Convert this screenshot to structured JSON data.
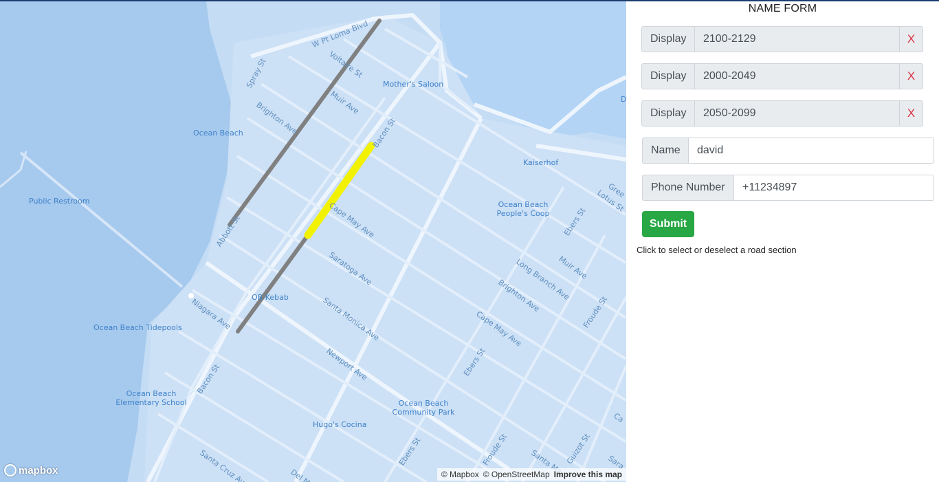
{
  "map": {
    "pois": {
      "mothers_saloon": "Mother's Saloon",
      "ocean_beach": "Ocean Beach",
      "public_restroom": "Public Restroom",
      "kaiserhof": "Kaiserhof",
      "people_coop": "Ocean Beach People's Coop",
      "ob_kebab": "OB Kebab",
      "tidepools": "Ocean Beach Tidepools",
      "elementary": "Ocean Beach Elementary School",
      "community_park": "Ocean Beach Community Park",
      "hugos": "Hugo's Cocina",
      "d_label": "D"
    },
    "streets": {
      "pt_loma": "W Pt Loma Blvd",
      "voltaire": "Voltaire St",
      "spray": "Spray St",
      "muir1": "Muir Ave",
      "brighton1": "Brighton Ave",
      "bacon_top": "Bacon St",
      "cape_may1": "Cape May Ave",
      "abbott": "Abbott St",
      "saratoga": "Saratoga Ave",
      "santa_monica": "Santa Monica Ave",
      "niagara": "Niagara Ave",
      "newport": "Newport Ave",
      "bacon_bottom": "Bacon St",
      "santa_cruz": "Santa Cruz Ave",
      "del": "Del M",
      "ebers1": "Ebers St",
      "ebers2": "Ebers St",
      "ebers3": "Ebers St",
      "long_branch": "Long Branch Ave",
      "muir2": "Muir Ave",
      "brighton2": "Brighton Ave",
      "cape_may2": "Cape May Ave",
      "froude1": "Froude St",
      "froude2": "Froude St",
      "guizot": "Guizot St",
      "santa_ma": "Santa Ma",
      "lotus": "Lotus St",
      "gree": "Gree",
      "sara": "Sara",
      "ca": "Ca"
    },
    "highlight_color": "#f2f200",
    "selected_color": "#808080",
    "logo": "mapbox",
    "attribution": {
      "mapbox": "© Mapbox",
      "osm": "© OpenStreetMap",
      "improve": "Improve this map"
    }
  },
  "form": {
    "title": "NAME FORM",
    "displays": [
      {
        "prefix": "Display",
        "value": "2100-2129",
        "remove": "X"
      },
      {
        "prefix": "Display",
        "value": "2000-2049",
        "remove": "X"
      },
      {
        "prefix": "Display",
        "value": "2050-2099",
        "remove": "X"
      }
    ],
    "name": {
      "label": "Name",
      "value": "david"
    },
    "phone": {
      "label": "Phone Number",
      "value": "+11234897"
    },
    "submit": "Submit",
    "hint": "Click to select or deselect a road section"
  }
}
